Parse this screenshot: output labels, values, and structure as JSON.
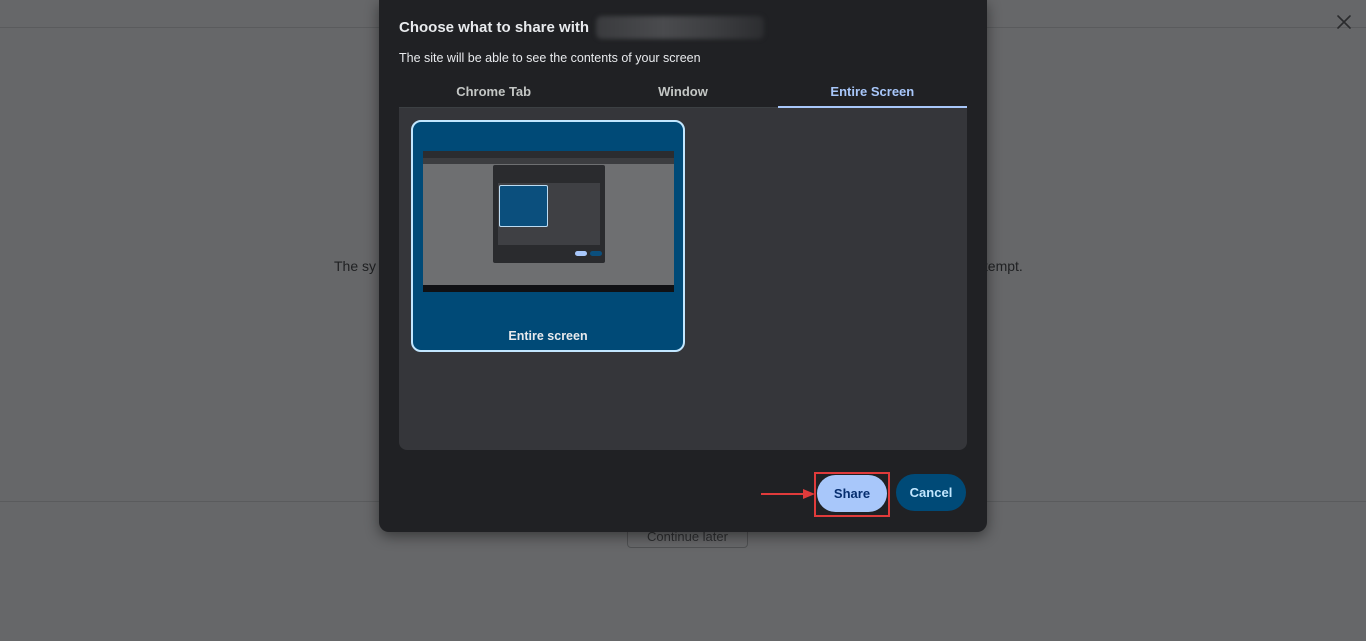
{
  "background_page": {
    "message_left": "The sy",
    "message_right": "ttempt.",
    "later_button": "Continue later"
  },
  "dialog": {
    "title": "Choose what to share with",
    "subtitle": "The site will be able to see the contents of your screen",
    "tabs": [
      {
        "label": "Chrome Tab",
        "active": false
      },
      {
        "label": "Window",
        "active": false
      },
      {
        "label": "Entire Screen",
        "active": true
      }
    ],
    "sources": [
      {
        "label": "Entire screen",
        "selected": true
      }
    ],
    "share_label": "Share",
    "cancel_label": "Cancel"
  },
  "colors": {
    "accent": "#a8c7fa",
    "selected_tile": "#004a77",
    "highlight_annotation": "#e03b3b"
  }
}
